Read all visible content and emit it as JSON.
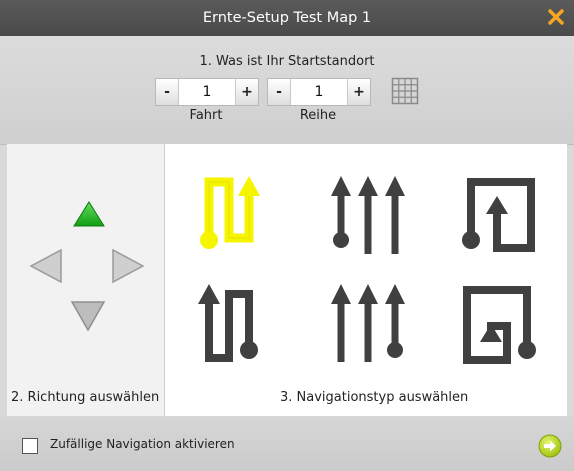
{
  "window": {
    "title": "Ernte-Setup Test Map 1",
    "close_icon": "close-icon",
    "accent_color": "#f5a623"
  },
  "start_location": {
    "heading": "1. Was ist Ihr Startstandort",
    "fahrt": {
      "minus": "-",
      "value": "1",
      "plus": "+",
      "label": "Fahrt"
    },
    "reihe": {
      "minus": "-",
      "value": "1",
      "plus": "+",
      "label": "Reihe"
    },
    "grid_icon": "grid-icon"
  },
  "direction": {
    "label": "2. Richtung auswählen",
    "up_icon": "arrow-up-icon",
    "left_icon": "arrow-left-icon",
    "right_icon": "arrow-right-icon",
    "down_icon": "arrow-down-icon",
    "selected": "up",
    "selected_color": "#2db82d"
  },
  "navigation": {
    "label": "3. Navigationstyp auswählen",
    "types": [
      {
        "icon": "serpentine-up-icon",
        "selected": true
      },
      {
        "icon": "parallel-rows-up-icon",
        "selected": false
      },
      {
        "icon": "spiral-up-icon",
        "selected": false
      },
      {
        "icon": "serpentine-down-icon",
        "selected": false
      },
      {
        "icon": "parallel-rows-down-icon",
        "selected": false
      },
      {
        "icon": "spiral-down-icon",
        "selected": false
      }
    ],
    "selected_color": "#f5f500"
  },
  "footer": {
    "random_label": "Zufällige Navigation aktivieren",
    "random_checked": false,
    "next_icon": "next-arrow-icon",
    "next_color": "#b5d818"
  }
}
